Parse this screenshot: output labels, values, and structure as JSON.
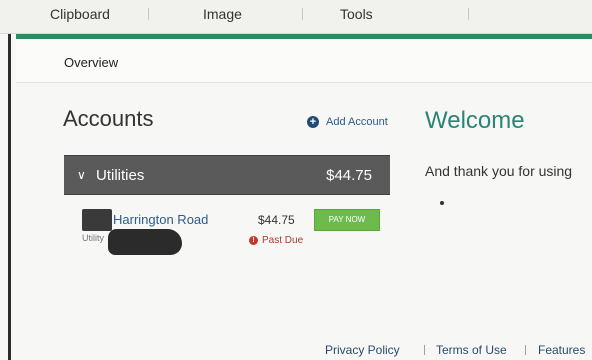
{
  "ribbon": {
    "tabs": [
      "Clipboard",
      "Image",
      "Tools"
    ]
  },
  "overview": {
    "label": "Overview"
  },
  "accounts": {
    "title": "Accounts",
    "add_account_label": "Add Account",
    "group": {
      "label": "Utilities",
      "total": "$44.75"
    },
    "items": [
      {
        "name": "Harrington Road",
        "type": "Utility",
        "amount": "$44.75",
        "status": "Past Due",
        "action": "PAY NOW"
      }
    ]
  },
  "welcome": {
    "title": "Welcome",
    "message": "And thank you for using"
  },
  "footer": {
    "links": [
      "Privacy Policy",
      "Terms of Use",
      "Features"
    ]
  },
  "colors": {
    "accent_green": "#2d8a5e",
    "link_blue": "#2b5c8f",
    "pay_now_green": "#6dbb4d",
    "past_due_red": "#c0392b",
    "welcome_teal": "#2c8476"
  }
}
